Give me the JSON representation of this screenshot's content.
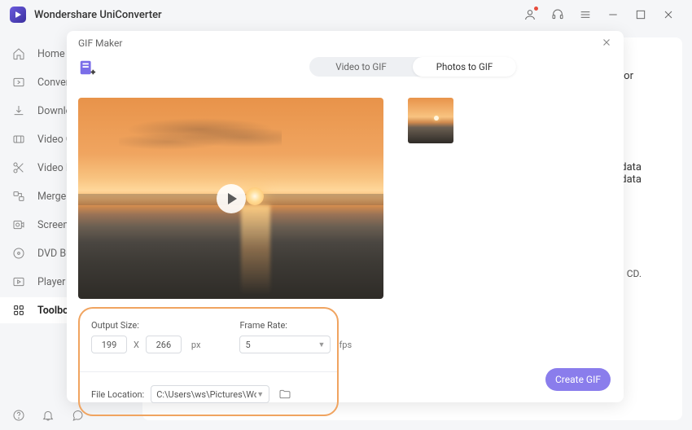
{
  "app": {
    "title": "Wondershare UniConverter"
  },
  "sidebar": {
    "items": [
      {
        "label": "Home"
      },
      {
        "label": "Converter"
      },
      {
        "label": "Downloader"
      },
      {
        "label": "Video Compressor"
      },
      {
        "label": "Video Editor"
      },
      {
        "label": "Merger"
      },
      {
        "label": "Screen Recorder"
      },
      {
        "label": "DVD Burner"
      },
      {
        "label": "Player"
      },
      {
        "label": "Toolbox"
      }
    ]
  },
  "bg": {
    "text1": "tor",
    "text2a": "data",
    "text2b": "etadata",
    "text3": "CD."
  },
  "modal": {
    "title": "GIF Maker",
    "tabs": {
      "video": "Video to GIF",
      "photos": "Photos to GIF"
    },
    "output_size_label": "Output Size:",
    "width": "199",
    "height": "266",
    "x": "X",
    "px": "px",
    "frame_rate_label": "Frame Rate:",
    "frame_rate_value": "5",
    "fps": "fps",
    "file_location_label": "File Location:",
    "file_location_value": "C:\\Users\\ws\\Pictures\\Wonders",
    "create": "Create GIF"
  }
}
